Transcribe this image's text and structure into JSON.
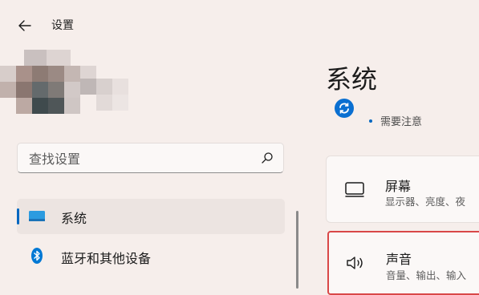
{
  "header": {
    "title": "设置"
  },
  "search": {
    "placeholder": "查找设置"
  },
  "sidebar": {
    "items": [
      {
        "label": "系统",
        "selected": true,
        "icon": "monitor-icon"
      },
      {
        "label": "蓝牙和其他设备",
        "selected": false,
        "icon": "bluetooth-icon"
      }
    ]
  },
  "main": {
    "title": "系统",
    "update_status": "需要注意",
    "cards": [
      {
        "title": "屏幕",
        "subtitle": "显示器、亮度、夜",
        "icon": "display-icon"
      },
      {
        "title": "声音",
        "subtitle": "音量、输出、输入",
        "icon": "speaker-icon",
        "highlighted": true
      }
    ]
  },
  "colors": {
    "accent": "#0067c0",
    "highlight": "#d94848",
    "background": "#f6eeeb"
  }
}
